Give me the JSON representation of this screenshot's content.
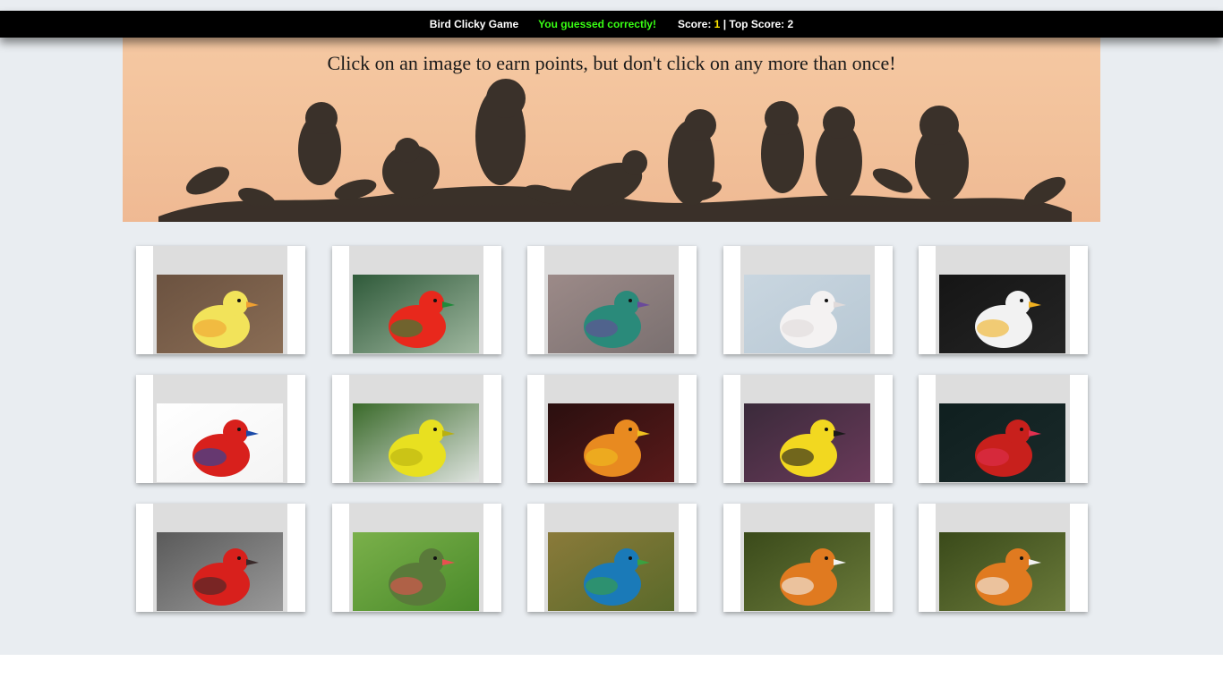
{
  "navbar": {
    "brand": "Bird Clicky Game",
    "status_message": "You guessed correctly!",
    "status_color": "#39ff14",
    "score_label": "Score: ",
    "score": "1",
    "separator": " | ",
    "top_score_label": "Top Score: ",
    "top_score": "2"
  },
  "hero": {
    "instruction": "Click on an image to earn points, but don't click on any more than once!"
  },
  "cards": [
    {
      "bird": "duckling",
      "bg": [
        "#6b5240",
        "#8a6d55"
      ],
      "body": "#f2e35a",
      "accent": "#f0a030"
    },
    {
      "bird": "king-parrot",
      "bg": [
        "#2f5a3a",
        "#a0b8a0"
      ],
      "body": "#e8281c",
      "accent": "#1f8a3a"
    },
    {
      "bird": "hummingbird",
      "bg": [
        "#9c8a88",
        "#7a7070"
      ],
      "body": "#2a8a7a",
      "accent": "#6a4a9a"
    },
    {
      "bird": "dove",
      "bg": [
        "#c9d6e0",
        "#b8c8d4"
      ],
      "body": "#f4f2f2",
      "accent": "#e0dada"
    },
    {
      "bird": "bald-eagle",
      "bg": [
        "#151515",
        "#252525"
      ],
      "body": "#f2f2f2",
      "accent": "#f0b020"
    },
    {
      "bird": "macaw",
      "bg": [
        "#ffffff",
        "#f4f4f4"
      ],
      "body": "#d8201c",
      "accent": "#1a4aa8"
    },
    {
      "bird": "yellow-bird-flying",
      "bg": [
        "#3a6a2a",
        "#dfe4e0"
      ],
      "body": "#e8e020",
      "accent": "#b8b010"
    },
    {
      "bird": "golden-pheasant",
      "bg": [
        "#2a0f0f",
        "#5a1a1a"
      ],
      "body": "#e88a20",
      "accent": "#f0c020"
    },
    {
      "bird": "weaver",
      "bg": [
        "#3a2a3a",
        "#6a3a5a"
      ],
      "body": "#f2d820",
      "accent": "#1a1a1a"
    },
    {
      "bird": "red-bird-flowers",
      "bg": [
        "#0f1f1f",
        "#1a2a2a"
      ],
      "body": "#c8201c",
      "accent": "#e03050"
    },
    {
      "bird": "cardinal",
      "bg": [
        "#5a5a5a",
        "#9a9a9a"
      ],
      "body": "#d8201c",
      "accent": "#3a2a2a"
    },
    {
      "bird": "hummingbird-feeder",
      "bg": [
        "#7ab04a",
        "#4a8a2a"
      ],
      "body": "#5a7a3a",
      "accent": "#e85050"
    },
    {
      "bird": "peacock",
      "bg": [
        "#8a7a3a",
        "#5a6a2a"
      ],
      "body": "#1a7ab8",
      "accent": "#3aa040"
    },
    {
      "bird": "mandarin-duck",
      "bg": [
        "#3a4a1a",
        "#6a7a3a"
      ],
      "body": "#e07a20",
      "accent": "#f2f2f2"
    },
    {
      "bird": "mandarin-duck-2",
      "bg": [
        "#3a4a1a",
        "#6a7a3a"
      ],
      "body": "#e07a20",
      "accent": "#f2f2f2"
    }
  ]
}
